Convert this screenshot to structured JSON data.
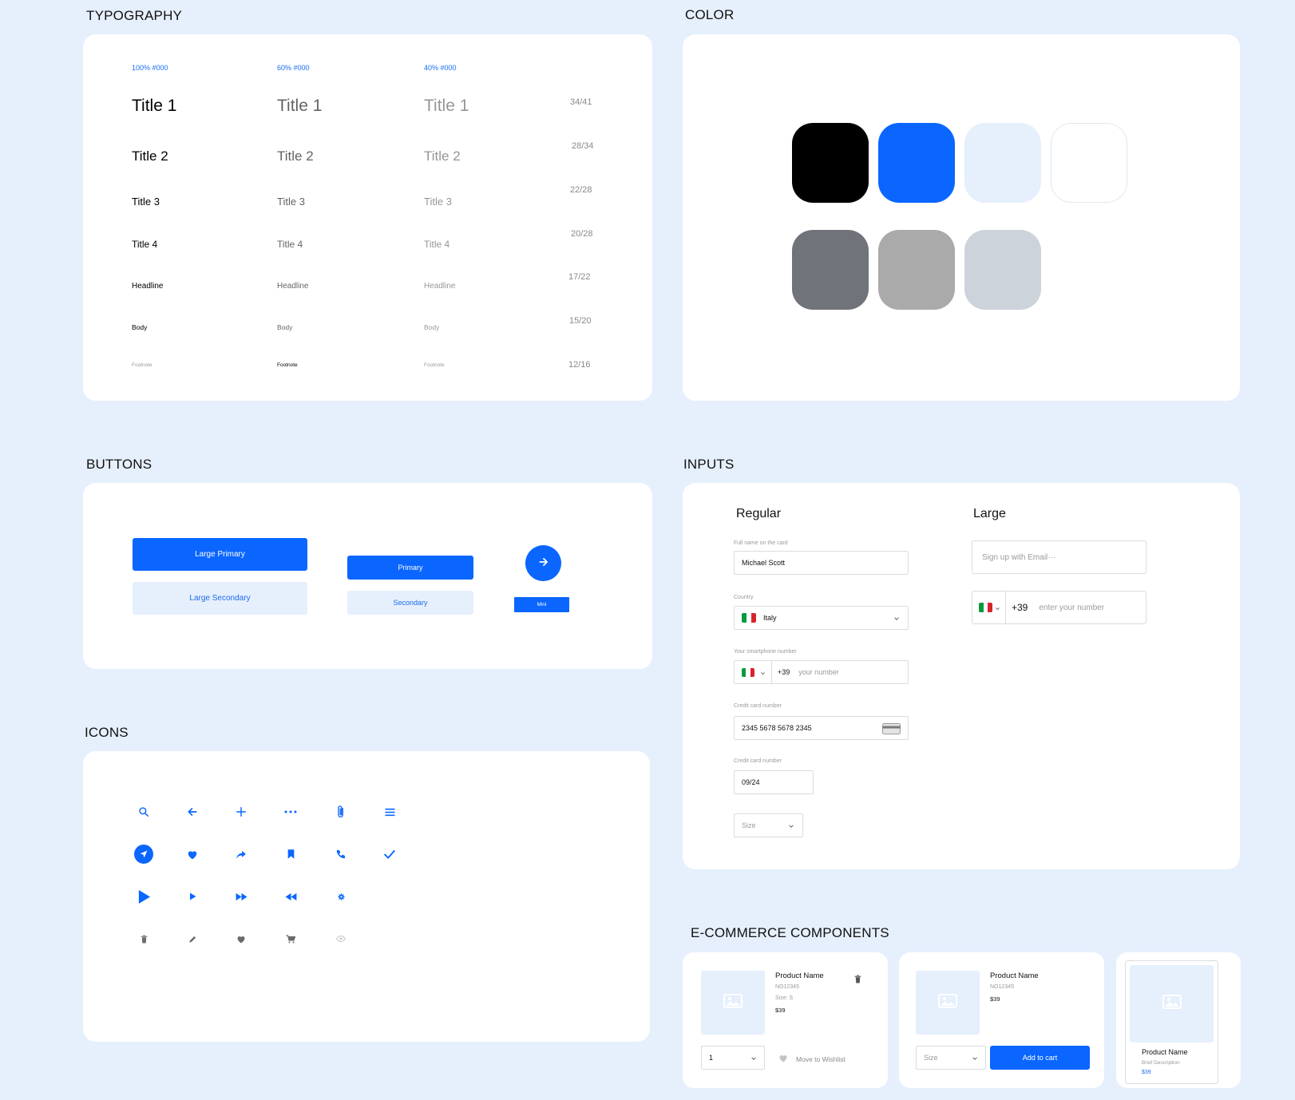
{
  "sections": {
    "typography": "TYPOGRAPHY",
    "color": "COLOR",
    "buttons": "BUTTONS",
    "inputs": "INPUTS",
    "icons": "ICONS",
    "ecommerce": "E-COMMERCE COMPONENTS"
  },
  "typography": {
    "headers": [
      "100% #000",
      "60% #000",
      "40% #000"
    ],
    "rows": [
      {
        "label": "Title 1",
        "meta": "34/41"
      },
      {
        "label": "Title 2",
        "meta": "28/34"
      },
      {
        "label": "Title 3",
        "meta": "22/28"
      },
      {
        "label": "Title 4",
        "meta": "20/28"
      },
      {
        "label": "Headline",
        "meta": "17/22"
      },
      {
        "label": "Body",
        "meta": "15/20"
      },
      {
        "label": "Footnote",
        "meta": "12/16"
      }
    ]
  },
  "colors": {
    "row1": [
      "#000000",
      "#0a66ff",
      "#e6effc",
      "#ffffff"
    ],
    "row2": [
      "#70737a",
      "#aaaaaa",
      "#cdd3da"
    ]
  },
  "buttons": {
    "large_primary": "Large Primary",
    "large_secondary": "Large Secondary",
    "primary": "Primary",
    "secondary": "Secondary",
    "mini": "Mini",
    "fab_icon": "arrow-right-icon"
  },
  "icons": {
    "accent": "#0a66ff",
    "muted": "#6b6b6b",
    "row1": [
      "search-icon",
      "arrow-left-icon",
      "plus-icon",
      "more-icon",
      "paperclip-icon",
      "menu-icon"
    ],
    "row2": [
      "send-icon",
      "heart-icon",
      "share-icon",
      "bookmark-icon",
      "phone-icon",
      "check-icon"
    ],
    "row3": [
      "play-large-icon",
      "play-icon",
      "fast-forward-icon",
      "rewind-icon",
      "gear-icon"
    ],
    "row4": [
      "trash-icon",
      "pencil-icon",
      "heart-outline-icon",
      "cart-icon",
      "eye-icon"
    ]
  },
  "inputs": {
    "regular_title": "Regular",
    "large_title": "Large",
    "full_name_label": "Full name on the card",
    "full_name_value": "Michael Scott",
    "country_label": "Country",
    "country_value": "Italy",
    "phone_label": "Your smartphone number",
    "phone_code": "+39",
    "phone_placeholder": "your number",
    "card_label": "Credit card number",
    "card_value": "2345 5678 5678 2345",
    "expiry_label": "Credit card number",
    "expiry_value": "09/24",
    "size_placeholder": "Size",
    "large_email_placeholder": "Sign up with Email···",
    "large_phone_code": "+39",
    "large_phone_placeholder": "enter your number"
  },
  "ecommerce": {
    "card1": {
      "name": "Product Name",
      "sku": "NO12345",
      "size": "Size: S",
      "price": "$39",
      "qty": "1",
      "wishlist": "Move to Wishlist"
    },
    "card2": {
      "name": "Product Name",
      "sku": "NO12345",
      "price": "$39",
      "size_placeholder": "Size",
      "add_to_cart": "Add to cart"
    },
    "card3": {
      "name": "Product Name",
      "description": "Brief Description",
      "price": "$39"
    }
  }
}
